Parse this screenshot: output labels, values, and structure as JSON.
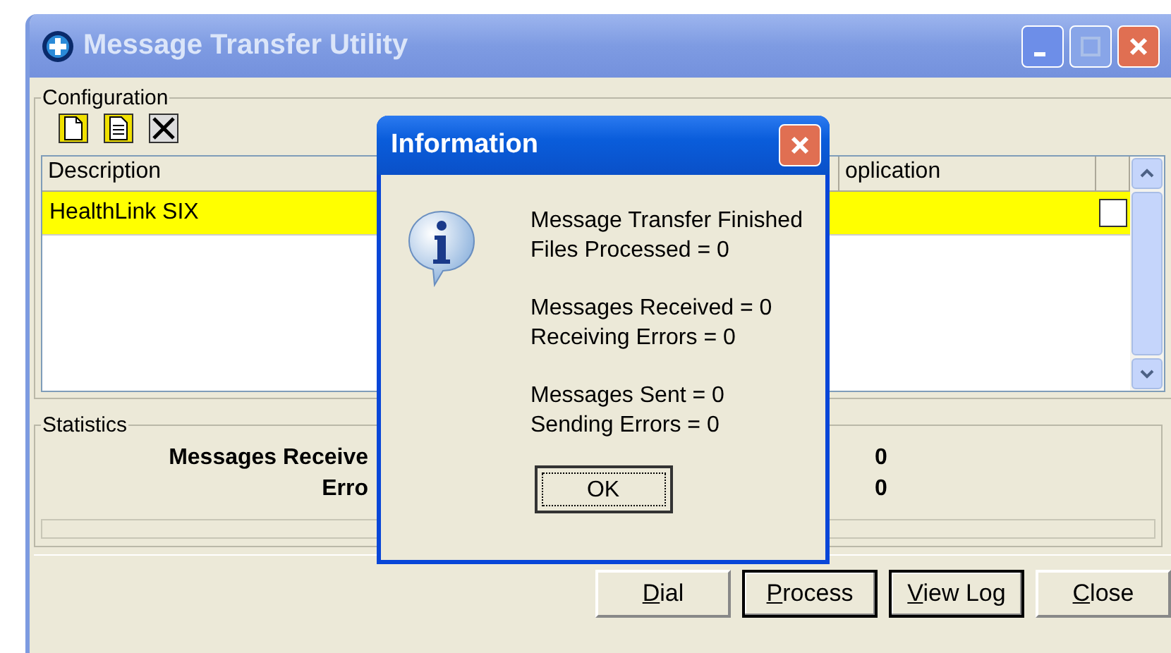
{
  "window": {
    "title": "Message Transfer Utility"
  },
  "configuration": {
    "label": "Configuration",
    "columns": [
      "Description",
      "oplication"
    ],
    "rows": [
      {
        "description": "HealthLink SIX",
        "checked": false,
        "selected": true
      }
    ]
  },
  "statistics": {
    "label": "Statistics",
    "rows": [
      {
        "label": "Messages Receive",
        "value": "0"
      },
      {
        "label": "Erro",
        "value": "0"
      }
    ]
  },
  "buttons": [
    {
      "label": "Dial",
      "default": false
    },
    {
      "label": "Process",
      "default": true
    },
    {
      "label": "View Log",
      "default": true
    },
    {
      "label": "Close",
      "default": false
    }
  ],
  "dialog": {
    "title": "Information",
    "paragraphs": [
      [
        "Message Transfer Finished",
        "Files Processed = 0"
      ],
      [
        "Messages Received = 0",
        "Receiving Errors = 0"
      ],
      [
        "Messages Sent = 0",
        "Sending Errors = 0"
      ]
    ],
    "button": "OK"
  }
}
